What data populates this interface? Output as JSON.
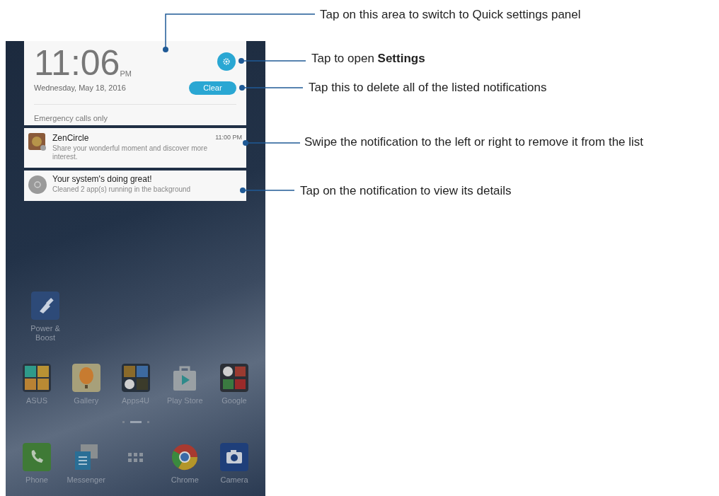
{
  "lock_card": {
    "time": "11:06",
    "ampm": "PM",
    "date": "Wednesday, May 18, 2016",
    "clear_button": "Clear",
    "status": "Emergency calls only"
  },
  "notifications": [
    {
      "kind": "app",
      "title": "ZenCircle",
      "time": "11:00 PM",
      "body": "Share your wonderful moment and discover more interest."
    },
    {
      "kind": "system",
      "title": "Your system's doing great!",
      "body": "Cleaned 2 app(s) running in the background"
    }
  ],
  "home_apps": [
    {
      "kind": "boost",
      "label": "Power & Boost"
    }
  ],
  "app_row": [
    {
      "kind": "asus",
      "label": "ASUS"
    },
    {
      "kind": "gallery",
      "label": "Gallery"
    },
    {
      "kind": "apps4u",
      "label": "Apps4U"
    },
    {
      "kind": "store",
      "label": "Play Store"
    },
    {
      "kind": "google",
      "label": "Google"
    }
  ],
  "dock": [
    {
      "kind": "phone",
      "label": "Phone"
    },
    {
      "kind": "messenger",
      "label": "Messenger"
    },
    {
      "kind": "drawer"
    },
    {
      "kind": "chrome",
      "label": "Chrome"
    },
    {
      "kind": "camera",
      "label": "Camera"
    }
  ],
  "page_dots": [
    {
      "selected": false
    },
    {
      "selected": true
    },
    {
      "selected": false
    }
  ],
  "annotations": [
    {
      "text": "Tap on this area to switch to Quick settings panel"
    },
    {
      "text": "Tap to open **Settings**"
    },
    {
      "text": "Tap this to delete all of the listed notifications"
    },
    {
      "text": "Swipe the notification to the left or right to remove it from the list"
    },
    {
      "text": "Tap on the notification to view its details"
    }
  ]
}
